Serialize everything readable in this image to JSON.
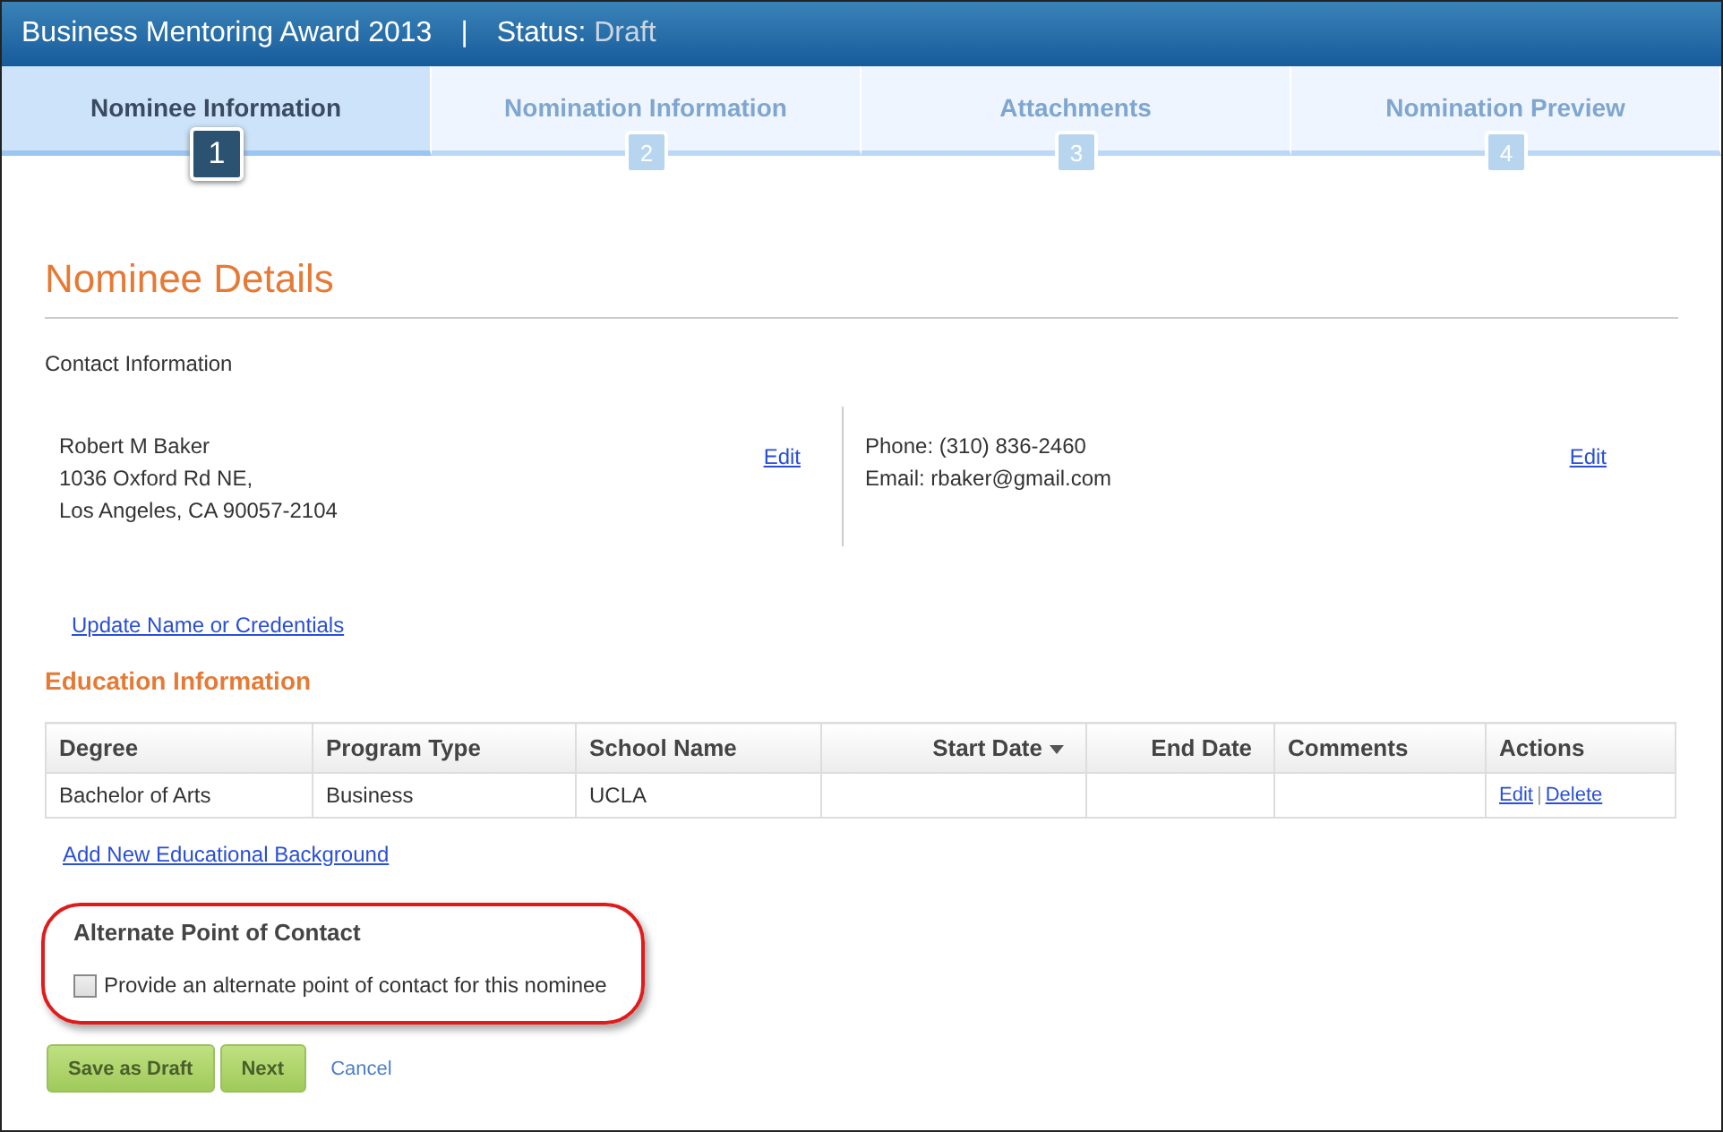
{
  "header": {
    "title": "Business Mentoring Award 2013",
    "separator": "|",
    "status_label": "Status:",
    "status_value": "Draft"
  },
  "steps": [
    {
      "label": "Nominee Information",
      "number": "1",
      "selected": true
    },
    {
      "label": "Nomination Information",
      "number": "2",
      "selected": false
    },
    {
      "label": "Attachments",
      "number": "3",
      "selected": false
    },
    {
      "label": "Nomination Preview",
      "number": "4",
      "selected": false
    }
  ],
  "section_title": "Nominee Details",
  "contact": {
    "heading": "Contact Information",
    "address_lines": [
      "Robert M Baker",
      "1036 Oxford Rd NE,",
      "Los Angeles, CA 90057-2104"
    ],
    "address_edit": "Edit",
    "contact_lines": [
      "Phone: (310) 836-2460",
      "Email: rbaker@gmail.com"
    ],
    "contact_edit": "Edit"
  },
  "update_link": "Update Name or Credentials",
  "education": {
    "title": "Education Information",
    "columns": [
      {
        "label": "Degree",
        "sorted": false
      },
      {
        "label": "Program Type",
        "sorted": false
      },
      {
        "label": "School Name",
        "sorted": false
      },
      {
        "label": "Start Date",
        "sorted": true
      },
      {
        "label": "End Date",
        "sorted": false
      },
      {
        "label": "Comments",
        "sorted": false
      },
      {
        "label": "Actions",
        "sorted": false
      }
    ],
    "rows": [
      {
        "cells": [
          "Bachelor of Arts",
          "Business",
          "UCLA",
          "",
          "",
          ""
        ],
        "actions": [
          "Edit",
          "Delete"
        ],
        "actions_separator": "|"
      }
    ],
    "add_link": "Add New Educational Background"
  },
  "alternate": {
    "title": "Alternate Point of Contact",
    "checkbox": {
      "label": "Provide an alternate point of contact for this nominee",
      "checked": false
    }
  },
  "buttons": [
    {
      "label": "Save as Draft"
    },
    {
      "label": "Next"
    }
  ],
  "cancel_link": "Cancel"
}
